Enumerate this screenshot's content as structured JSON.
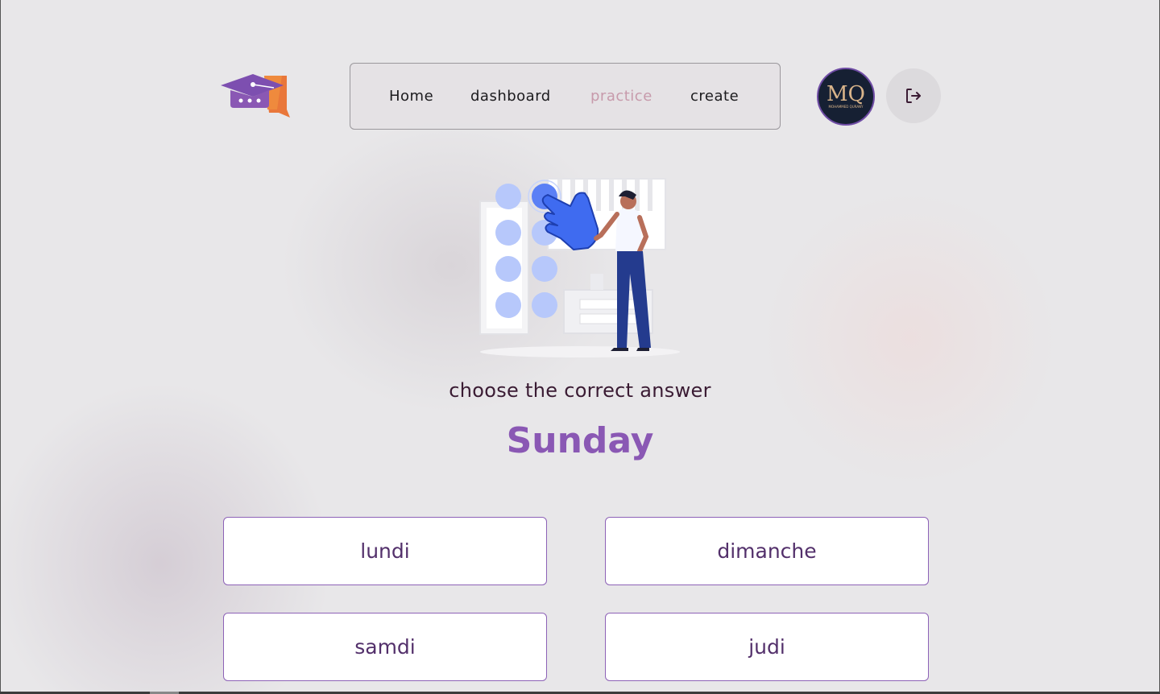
{
  "nav": {
    "items": [
      {
        "label": "Home",
        "active": false
      },
      {
        "label": "dashboard",
        "active": false
      },
      {
        "label": "practice",
        "active": true
      },
      {
        "label": "create",
        "active": false
      }
    ]
  },
  "avatar": {
    "initials": "MQ",
    "caption": "MOHAMMED QURANY"
  },
  "quiz": {
    "instruction": "choose the correct answer",
    "word": "Sunday",
    "options": [
      "lundi",
      "dimanche",
      "samdi",
      "judi"
    ]
  },
  "colors": {
    "accent": "#8a58b4",
    "active_nav": "#c79aab",
    "option_border": "#8d62b7",
    "option_text": "#53306b"
  },
  "icons": {
    "logo": "graduation-cap-chat-icon",
    "logout": "logout-icon"
  }
}
